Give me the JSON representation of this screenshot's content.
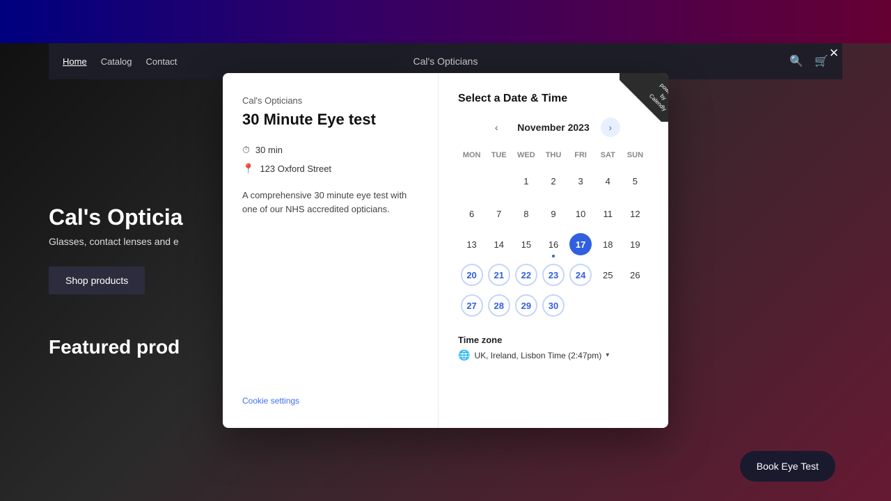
{
  "background": {
    "top_bar_gradient": "linear-gradient(90deg, #0000ff, #6600cc, #cc0066)"
  },
  "navbar": {
    "links": [
      {
        "label": "Home",
        "active": true
      },
      {
        "label": "Catalog",
        "active": false
      },
      {
        "label": "Contact",
        "active": false
      }
    ],
    "brand": "Cal's Opticians",
    "icons": [
      "search",
      "cart",
      "close"
    ]
  },
  "site_content": {
    "hero_title": "Cal's Opticia",
    "hero_subtitle": "Glasses, contact lenses and e",
    "shop_button": "Shop products",
    "featured_title": "Featured prod"
  },
  "modal": {
    "provider": "Cal's Opticians",
    "title": "30 Minute Eye test",
    "duration": "30 min",
    "location": "123 Oxford Street",
    "description": "A comprehensive 30 minute eye test with one of our NHS accredited opticians.",
    "cookie_settings": "Cookie settings",
    "calendar": {
      "header": "Select a Date & Time",
      "month": "November 2023",
      "days_of_week": [
        "MON",
        "TUE",
        "WED",
        "THU",
        "FRI",
        "SAT",
        "SUN"
      ],
      "weeks": [
        [
          null,
          null,
          1,
          2,
          3,
          4,
          5
        ],
        [
          6,
          7,
          8,
          9,
          10,
          11,
          12
        ],
        [
          13,
          14,
          15,
          16,
          17,
          18,
          19
        ],
        [
          20,
          21,
          22,
          23,
          24,
          25,
          26
        ],
        [
          27,
          28,
          29,
          30,
          null,
          null,
          null
        ]
      ],
      "today": 17,
      "available": [
        20,
        21,
        22,
        23,
        24,
        27,
        28,
        29,
        30
      ],
      "has_dot": [
        16
      ]
    },
    "timezone": {
      "label": "Time zone",
      "value": "UK, Ireland, Lisbon Time (2:47pm)"
    }
  },
  "book_button": "Book Eye Test",
  "close_button": "×",
  "calendly_badge": "powered\nby\nCalendly"
}
